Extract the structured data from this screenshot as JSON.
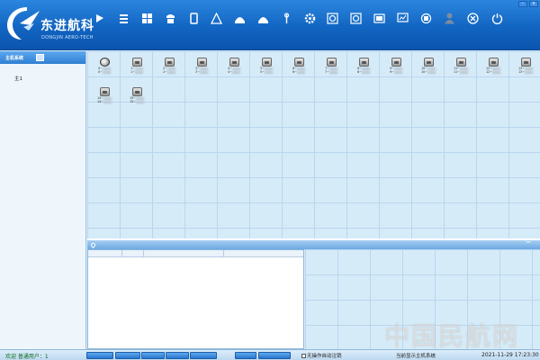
{
  "logo": {
    "name_cn": "东进航科",
    "name_en": "DONGJIN AERO-TECH"
  },
  "toolbar": {
    "items": [
      {
        "label": "",
        "icon": "arrow-icon",
        "enabled": true
      },
      {
        "label": "",
        "icon": "list-icon",
        "enabled": true
      },
      {
        "label": "",
        "icon": "grid-icon",
        "enabled": true
      },
      {
        "label": "",
        "icon": "phone-icon",
        "enabled": true
      },
      {
        "label": "",
        "icon": "book-icon",
        "enabled": true
      },
      {
        "label": "",
        "icon": "warning-icon",
        "enabled": true
      },
      {
        "label": "",
        "icon": "dome-icon",
        "enabled": true
      },
      {
        "label": "",
        "icon": "dome-icon",
        "enabled": true
      },
      {
        "label": "",
        "icon": "antenna-icon",
        "enabled": true
      },
      {
        "label": "",
        "icon": "gear-icon",
        "enabled": true
      },
      {
        "label": "",
        "icon": "target-icon",
        "enabled": true
      },
      {
        "label": "",
        "icon": "target-icon",
        "enabled": true
      },
      {
        "label": "",
        "icon": "window-icon",
        "enabled": true
      },
      {
        "label": "",
        "icon": "chart-icon",
        "enabled": true
      },
      {
        "label": "",
        "icon": "settings-icon",
        "enabled": true
      },
      {
        "label": "",
        "icon": "user-icon",
        "enabled": false
      },
      {
        "label": "",
        "icon": "close-circle-icon",
        "enabled": true
      },
      {
        "label": "",
        "icon": "power-icon",
        "enabled": true
      }
    ]
  },
  "sidebar": {
    "header": "主机系统",
    "tree_item": "主1"
  },
  "grid": {
    "cells": [
      {
        "line1": "0~",
        "line2": "0~",
        "icon": "speaker-icon"
      },
      {
        "line1": "1~",
        "line2": "1~",
        "icon": "phone-icon"
      },
      {
        "line1": "2~",
        "line2": "2~",
        "icon": "phone-icon"
      },
      {
        "line1": "3~",
        "line2": "3~",
        "icon": "phone-icon"
      },
      {
        "line1": "4~",
        "line2": "4~",
        "icon": "phone-icon"
      },
      {
        "line1": "5~",
        "line2": "5~",
        "icon": "phone-icon"
      },
      {
        "line1": "6~",
        "line2": "6~",
        "icon": "phone-icon"
      },
      {
        "line1": "7~",
        "line2": "7~",
        "icon": "phone-icon"
      },
      {
        "line1": "8~",
        "line2": "8~",
        "icon": "phone-icon"
      },
      {
        "line1": "9~",
        "line2": "9~",
        "icon": "phone-icon"
      },
      {
        "line1": "10~",
        "line2": "10~",
        "icon": "phone-icon"
      },
      {
        "line1": "11~",
        "line2": "11~",
        "icon": "phone-icon"
      },
      {
        "line1": "12~",
        "line2": "12~",
        "icon": "phone-icon"
      },
      {
        "line1": "13~",
        "line2": "13~",
        "icon": "phone-icon"
      },
      {
        "line1": "14~",
        "line2": "14~",
        "icon": "phone-icon"
      },
      {
        "line1": "15~",
        "line2": "15~",
        "icon": "phone-icon"
      }
    ]
  },
  "section": {
    "title": ""
  },
  "message_table": {
    "columns": [
      "",
      "",
      "",
      ""
    ]
  },
  "status": {
    "welcome": "欢迎  普通用户：1",
    "buttons": [
      "",
      "",
      "",
      "",
      "",
      "",
      ""
    ],
    "auto_logout": "无操作自动注销",
    "mode": "当前显示主机系统",
    "datetime": "2021-11-29  17:23:30"
  },
  "watermark": "中国民航网"
}
